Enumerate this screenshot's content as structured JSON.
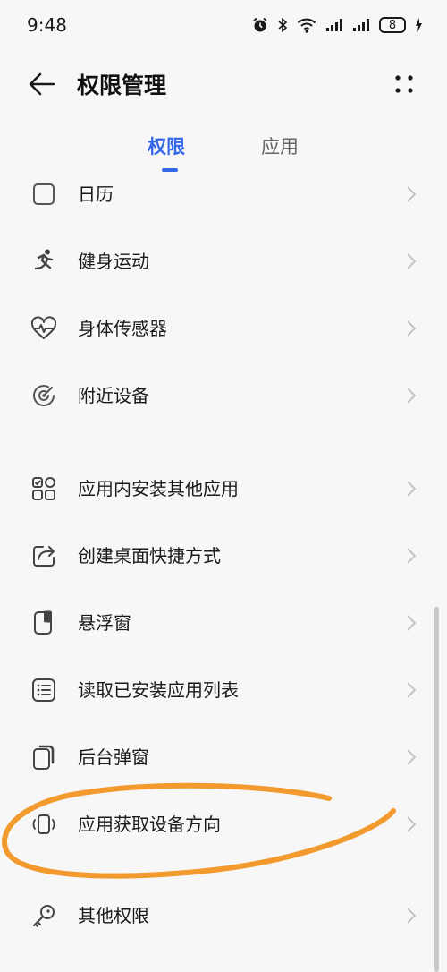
{
  "status_bar": {
    "time": "9:48",
    "battery_level": "8",
    "icons": [
      "alarm-icon",
      "bluetooth-icon",
      "wifi-icon",
      "signal-icon",
      "signal-icon",
      "battery-icon",
      "charging-icon"
    ]
  },
  "header": {
    "title": "权限管理",
    "back_icon": "back-arrow-icon",
    "more_icon": "more-icon"
  },
  "tabs": [
    {
      "label": "权限",
      "active": true
    },
    {
      "label": "应用",
      "active": false
    }
  ],
  "permissions": [
    {
      "label": "日历",
      "icon": "calendar-icon"
    },
    {
      "label": "健身运动",
      "icon": "running-person-icon"
    },
    {
      "label": "身体传感器",
      "icon": "heart-rate-icon"
    },
    {
      "label": "附近设备",
      "icon": "nearby-devices-icon"
    },
    {
      "label": "应用内安装其他应用",
      "icon": "apps-grid-icon"
    },
    {
      "label": "创建桌面快捷方式",
      "icon": "shortcut-icon"
    },
    {
      "label": "悬浮窗",
      "icon": "floating-window-icon"
    },
    {
      "label": "读取已安装应用列表",
      "icon": "app-list-icon"
    },
    {
      "label": "后台弹窗",
      "icon": "background-popup-icon"
    },
    {
      "label": "应用获取设备方向",
      "icon": "device-orientation-icon"
    },
    {
      "label": "其他权限",
      "icon": "key-icon"
    }
  ],
  "colors": {
    "accent": "#3467e8",
    "background": "#f7f7f7",
    "annotation": "#f29a2e"
  }
}
